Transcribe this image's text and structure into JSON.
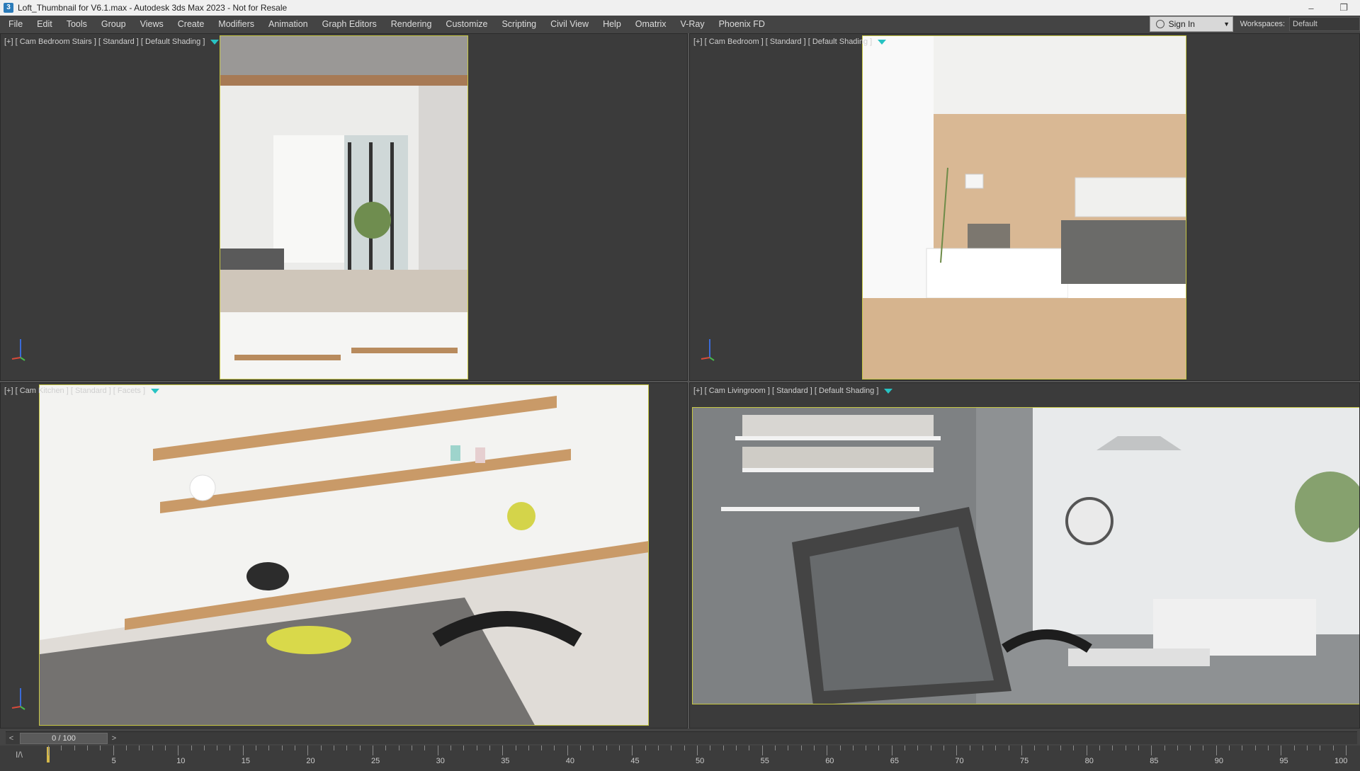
{
  "window": {
    "title": "Loft_Thumbnail for V6.1.max - Autodesk 3ds Max 2023 - Not for Resale",
    "app_icon": "3ds-max-icon",
    "minimize": "–",
    "restore": "❐"
  },
  "menu": {
    "items": [
      "File",
      "Edit",
      "Tools",
      "Group",
      "Views",
      "Create",
      "Modifiers",
      "Animation",
      "Graph Editors",
      "Rendering",
      "Customize",
      "Scripting",
      "Civil View",
      "Help",
      "Omatrix",
      "V-Ray",
      "Phoenix FD"
    ],
    "sign_in": "Sign In",
    "workspaces_label": "Workspaces:",
    "workspace_value": "Default"
  },
  "viewports": [
    {
      "label": "[+] [ Cam Bedroom Stairs ] [ Standard ] [ Default Shading ]",
      "scene": "bedroom-stairs"
    },
    {
      "label": "[+] [ Cam Bedroom ] [ Standard ] [ Default Shading ]",
      "scene": "bedroom"
    },
    {
      "label": "[+] [ Cam Kitchen ] [ Standard ] [ Facets ]",
      "scene": "kitchen"
    },
    {
      "label": "[+] [ Cam Livingroom ] [ Standard ] [ Default Shading ]",
      "scene": "livingroom"
    }
  ],
  "timeline": {
    "frame_display": "0 / 100",
    "prev": "<",
    "next": ">",
    "current_frame": 0,
    "ticks": [
      "5",
      "10",
      "15",
      "20",
      "25",
      "30",
      "35",
      "40",
      "45",
      "50",
      "55",
      "60",
      "65",
      "70",
      "75",
      "80",
      "85",
      "90",
      "95",
      "100"
    ]
  },
  "colors": {
    "frame_border": "#c7c743",
    "filter_icon": "#27c3c3",
    "viewport_bg": "#3b3b3b"
  }
}
